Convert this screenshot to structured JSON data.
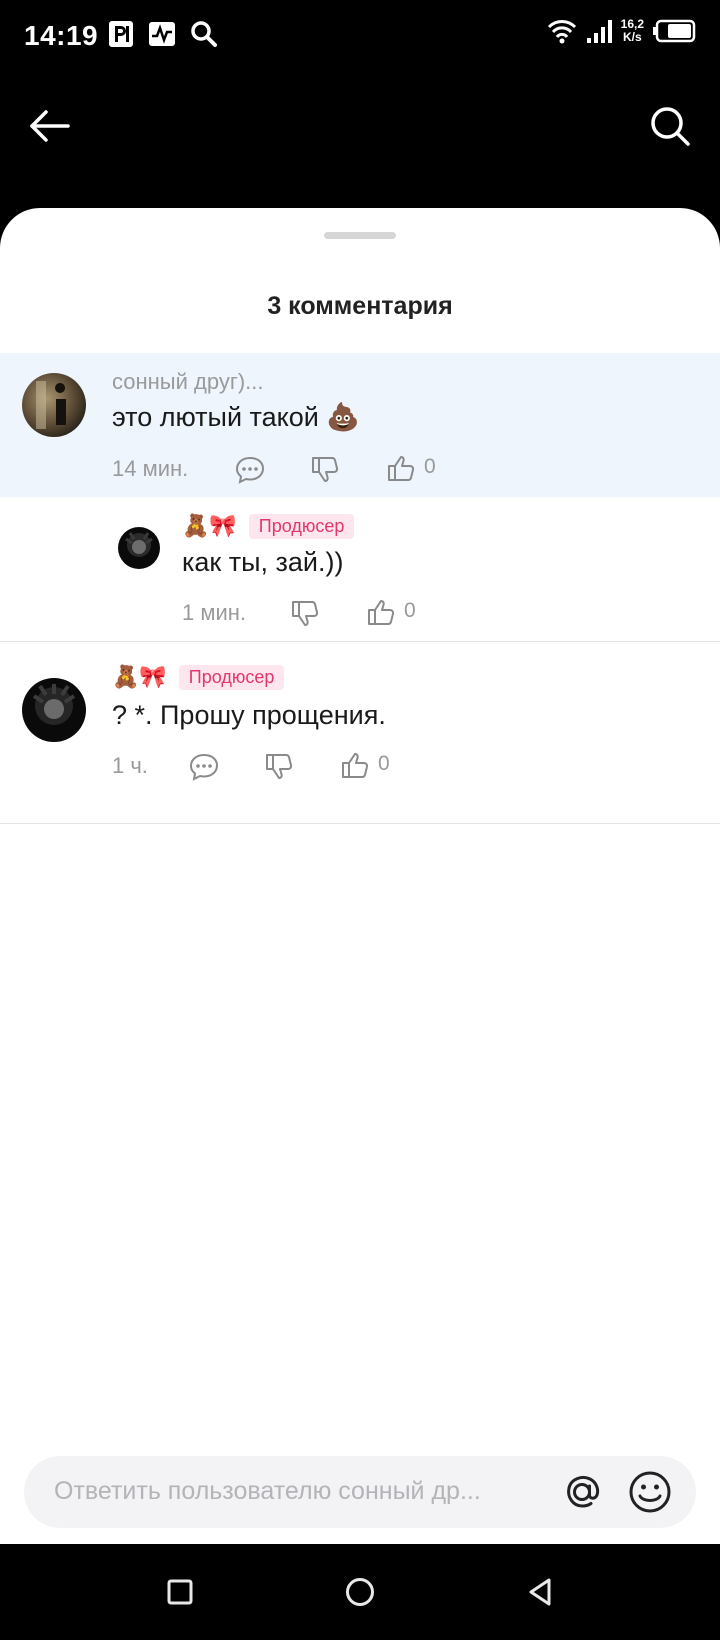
{
  "status_bar": {
    "time": "14:19",
    "speed_value": "16,2",
    "speed_unit": "K/s",
    "icons_left": [
      "parking-icon",
      "activity-icon",
      "search-icon"
    ],
    "icons_right": [
      "wifi-icon",
      "signal-icon",
      "battery-icon"
    ]
  },
  "app_bar": {
    "icons": [
      "back-arrow-icon",
      "search-icon"
    ]
  },
  "sheet": {
    "title": "3 комментария"
  },
  "comments": [
    {
      "author": "сонный друг)...",
      "text": "это лютый такой 💩",
      "time": "14 мин.",
      "likes": "0",
      "highlighted": true
    },
    {
      "author_emoji": "🧸🎀",
      "badge": "Продюсер",
      "text": "как ты, зай.))",
      "time": "1 мин.",
      "likes": "0",
      "is_reply": true
    },
    {
      "author_emoji": "🧸🎀",
      "badge": "Продюсер",
      "text": "? *. Прошу прощения.",
      "time": "1 ч.",
      "likes": "0"
    }
  ],
  "reply_input": {
    "placeholder": "Ответить пользователю сонный др..."
  },
  "colors": {
    "accent_badge": "#e2376b",
    "highlight_bg": "#eef5fd",
    "muted": "#9a9a9a"
  }
}
